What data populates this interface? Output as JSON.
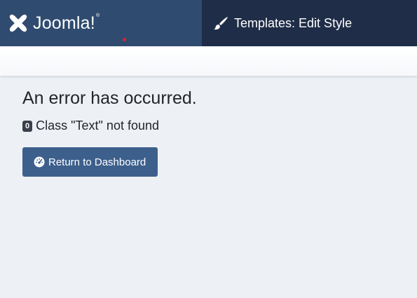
{
  "header": {
    "brand": {
      "name": "Joomla!",
      "registered": "®",
      "logo_icon": "joomla-logo-icon"
    },
    "page_title": "Templates: Edit Style",
    "page_title_icon": "paint-brush-icon"
  },
  "error": {
    "heading": "An error has occurred.",
    "code": "0",
    "message": "Class \"Text\" not found"
  },
  "actions": {
    "return_label": "Return to Dashboard",
    "return_icon": "dashboard-icon"
  },
  "colors": {
    "brand_bg": "#2f4b6f",
    "title_bg": "#1f2d48",
    "page_bg": "#edf1f6",
    "button_bg": "#3d5f8c",
    "indicator": "#d4262d"
  }
}
